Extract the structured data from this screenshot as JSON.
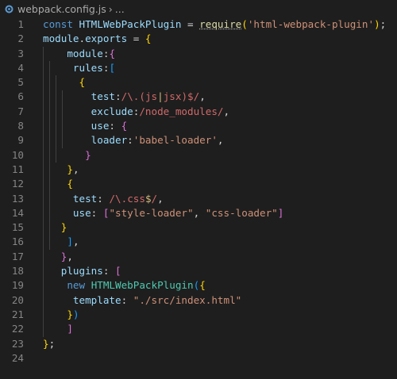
{
  "breadcrumb": {
    "file_name": "webpack.config.js",
    "separator": "›",
    "symbol": "..."
  },
  "editor": {
    "lines": [
      {
        "n": "1",
        "tokens": [
          [
            "t-kw",
            "const "
          ],
          [
            "t-var",
            "HTMLWebPackPlugin"
          ],
          [
            "t-pun",
            " = "
          ],
          [
            "t-fn squiggle",
            "require"
          ],
          [
            "t-y",
            "("
          ],
          [
            "t-str",
            "'html-webpack-plugin'"
          ],
          [
            "t-y",
            ")"
          ],
          [
            "t-pun",
            ";"
          ]
        ]
      },
      {
        "n": "2",
        "tokens": [
          [
            "t-var",
            "module"
          ],
          [
            "t-pun",
            "."
          ],
          [
            "t-var",
            "exports"
          ],
          [
            "t-pun",
            " = "
          ],
          [
            "t-y",
            "{"
          ]
        ]
      },
      {
        "n": "3",
        "tokens": [
          [
            "t-pun",
            "    "
          ],
          [
            "t-var",
            "module"
          ],
          [
            "t-pun",
            ":"
          ],
          [
            "t-p",
            "{"
          ]
        ]
      },
      {
        "n": "4",
        "tokens": [
          [
            "t-pun",
            "     "
          ],
          [
            "t-var",
            "rules"
          ],
          [
            "t-pun",
            ":"
          ],
          [
            "t-b",
            "["
          ]
        ]
      },
      {
        "n": "5",
        "tokens": [
          [
            "t-pun",
            "      "
          ],
          [
            "t-y",
            "{"
          ]
        ]
      },
      {
        "n": "6",
        "tokens": [
          [
            "t-pun",
            "        "
          ],
          [
            "t-var",
            "test"
          ],
          [
            "t-pun",
            ":"
          ],
          [
            "t-rx",
            "/\\.("
          ],
          [
            "t-rx",
            "js"
          ],
          [
            "t-esc",
            "|"
          ],
          [
            "t-rx",
            "jsx)$/"
          ],
          [
            "t-pun",
            ","
          ]
        ]
      },
      {
        "n": "7",
        "tokens": [
          [
            "t-pun",
            "        "
          ],
          [
            "t-var",
            "exclude"
          ],
          [
            "t-pun",
            ":"
          ],
          [
            "t-rx",
            "/node_modules/"
          ],
          [
            "t-pun",
            ","
          ]
        ]
      },
      {
        "n": "8",
        "tokens": [
          [
            "t-pun",
            "        "
          ],
          [
            "t-var",
            "use"
          ],
          [
            "t-pun",
            ": "
          ],
          [
            "t-p",
            "{"
          ]
        ]
      },
      {
        "n": "9",
        "tokens": [
          [
            "t-pun",
            "        "
          ],
          [
            "t-var",
            "loader"
          ],
          [
            "t-pun",
            ":"
          ],
          [
            "t-str",
            "'babel-loader'"
          ],
          [
            "t-pun",
            ","
          ]
        ]
      },
      {
        "n": "10",
        "tokens": [
          [
            "t-pun",
            "       "
          ],
          [
            "t-p",
            "}"
          ]
        ]
      },
      {
        "n": "11",
        "tokens": [
          [
            "t-pun",
            "    "
          ],
          [
            "t-y",
            "}"
          ],
          [
            "t-pun",
            ","
          ]
        ]
      },
      {
        "n": "12",
        "tokens": [
          [
            "t-pun",
            "    "
          ],
          [
            "t-y",
            "{"
          ]
        ]
      },
      {
        "n": "13",
        "tokens": [
          [
            "t-pun",
            "     "
          ],
          [
            "t-var",
            "test"
          ],
          [
            "t-pun",
            ": "
          ],
          [
            "t-rx",
            "/\\."
          ],
          [
            "t-rx",
            "css"
          ],
          [
            "t-esc",
            "$"
          ],
          [
            "t-rx",
            "/"
          ],
          [
            "t-pun",
            ","
          ]
        ]
      },
      {
        "n": "14",
        "tokens": [
          [
            "t-pun",
            "     "
          ],
          [
            "t-var",
            "use"
          ],
          [
            "t-pun",
            ": "
          ],
          [
            "t-p",
            "["
          ],
          [
            "t-str",
            "\"style-loader\""
          ],
          [
            "t-pun",
            ", "
          ],
          [
            "t-str",
            "\"css-loader\""
          ],
          [
            "t-p",
            "]"
          ]
        ]
      },
      {
        "n": "15",
        "tokens": [
          [
            "t-pun",
            "   "
          ],
          [
            "t-y",
            "}"
          ]
        ]
      },
      {
        "n": "16",
        "tokens": [
          [
            "t-pun",
            "    "
          ],
          [
            "t-b",
            "]"
          ],
          [
            "t-pun",
            ","
          ]
        ]
      },
      {
        "n": "17",
        "tokens": [
          [
            "t-pun",
            "   "
          ],
          [
            "t-p",
            "}"
          ],
          [
            "t-pun",
            ","
          ]
        ]
      },
      {
        "n": "18",
        "tokens": [
          [
            "t-pun",
            "   "
          ],
          [
            "t-var",
            "plugins"
          ],
          [
            "t-pun",
            ": "
          ],
          [
            "t-p",
            "["
          ]
        ]
      },
      {
        "n": "19",
        "tokens": [
          [
            "t-pun",
            "    "
          ],
          [
            "t-kw",
            "new "
          ],
          [
            "t-cls",
            "HTMLWebPackPlugin"
          ],
          [
            "t-b",
            "("
          ],
          [
            "t-y",
            "{"
          ]
        ]
      },
      {
        "n": "20",
        "tokens": [
          [
            "t-pun",
            "     "
          ],
          [
            "t-var",
            "template"
          ],
          [
            "t-pun",
            ": "
          ],
          [
            "t-str",
            "\"./src/index.html\""
          ]
        ]
      },
      {
        "n": "21",
        "tokens": [
          [
            "t-pun",
            "    "
          ],
          [
            "t-y",
            "}"
          ],
          [
            "t-b",
            ")"
          ]
        ]
      },
      {
        "n": "22",
        "tokens": [
          [
            "t-pun",
            "    "
          ],
          [
            "t-p",
            "]"
          ]
        ]
      },
      {
        "n": "23",
        "tokens": [
          [
            "t-y",
            "}"
          ],
          [
            "t-pun",
            ";"
          ]
        ]
      },
      {
        "n": "24",
        "tokens": []
      }
    ]
  }
}
